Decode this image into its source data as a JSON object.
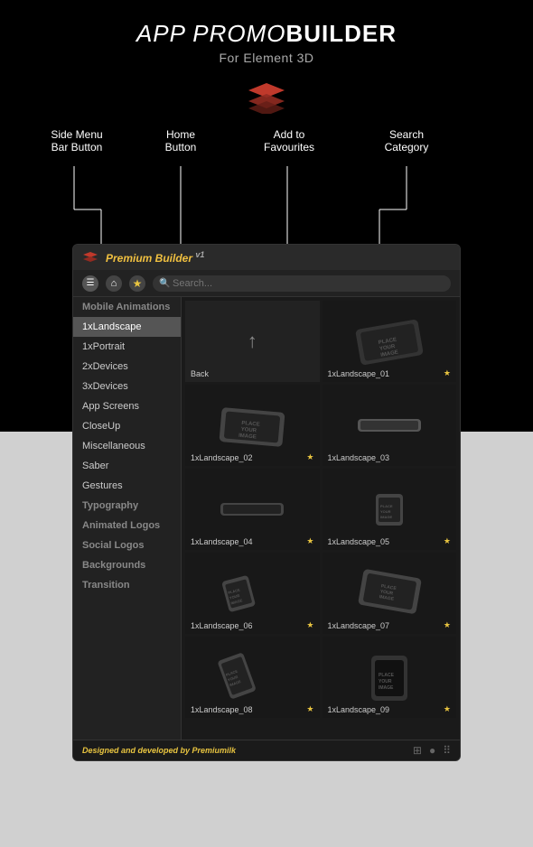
{
  "app": {
    "title_italic": "APP PROMO",
    "title_bold": "BUILDER",
    "subtitle": "For Element 3D"
  },
  "annotations": [
    {
      "id": "side-menu",
      "label": "Side Menu\nBar Button"
    },
    {
      "id": "home",
      "label": "Home\nButton"
    },
    {
      "id": "favourites",
      "label": "Add to\nFavourites"
    },
    {
      "id": "search",
      "label": "Search\nCategory"
    }
  ],
  "titlebar": {
    "app_name": "Premium Builder",
    "version": "v1"
  },
  "toolbar": {
    "search_placeholder": "Search..."
  },
  "sidebar": {
    "categories": [
      {
        "label": "Mobile Animations",
        "type": "category"
      },
      {
        "label": "1xLandscape",
        "type": "item",
        "active": true
      },
      {
        "label": "1xPortrait",
        "type": "item"
      },
      {
        "label": "2xDevices",
        "type": "item"
      },
      {
        "label": "3xDevices",
        "type": "item"
      },
      {
        "label": "App Screens",
        "type": "item"
      },
      {
        "label": "CloseUp",
        "type": "item"
      },
      {
        "label": "Miscellaneous",
        "type": "item"
      },
      {
        "label": "Saber",
        "type": "item"
      },
      {
        "label": "Gestures",
        "type": "item"
      },
      {
        "label": "Typography",
        "type": "category"
      },
      {
        "label": "Animated Logos",
        "type": "category"
      },
      {
        "label": "Social Logos",
        "type": "category"
      },
      {
        "label": "Backgrounds",
        "type": "category"
      },
      {
        "label": "Transition",
        "type": "category"
      }
    ]
  },
  "grid": {
    "cells": [
      {
        "id": "back",
        "label": "Back",
        "type": "back",
        "star": false
      },
      {
        "id": "1xLandscape_01",
        "label": "1xLandscape_01",
        "type": "phone-angle",
        "star": true
      },
      {
        "id": "1xLandscape_02",
        "label": "1xLandscape_02",
        "type": "phone-angle2",
        "star": true
      },
      {
        "id": "1xLandscape_03",
        "label": "1xLandscape_03",
        "type": "phone-flat",
        "star": false
      },
      {
        "id": "1xLandscape_04",
        "label": "1xLandscape_04",
        "type": "phone-side",
        "star": true
      },
      {
        "id": "1xLandscape_05",
        "label": "1xLandscape_05",
        "type": "phone-small",
        "star": true
      },
      {
        "id": "1xLandscape_06",
        "label": "1xLandscape_06",
        "type": "phone-tilt",
        "star": true
      },
      {
        "id": "1xLandscape_07",
        "label": "1xLandscape_07",
        "type": "phone-angle3",
        "star": true
      },
      {
        "id": "1xLandscape_08",
        "label": "1xLandscape_08",
        "type": "phone-tilt2",
        "star": true
      },
      {
        "id": "1xLandscape_09",
        "label": "1xLandscape_09",
        "type": "phone-front",
        "star": true
      }
    ]
  },
  "footer": {
    "text": "Designed and developed by",
    "brand": "Premiumilk",
    "grid_icon": "⊞",
    "circle_icon": "●",
    "menu_icon": "⠿"
  },
  "colors": {
    "accent": "#e8c440",
    "red": "#c0392b",
    "background_dark": "#1a1a1a",
    "background_gray": "#d0d0d0"
  }
}
